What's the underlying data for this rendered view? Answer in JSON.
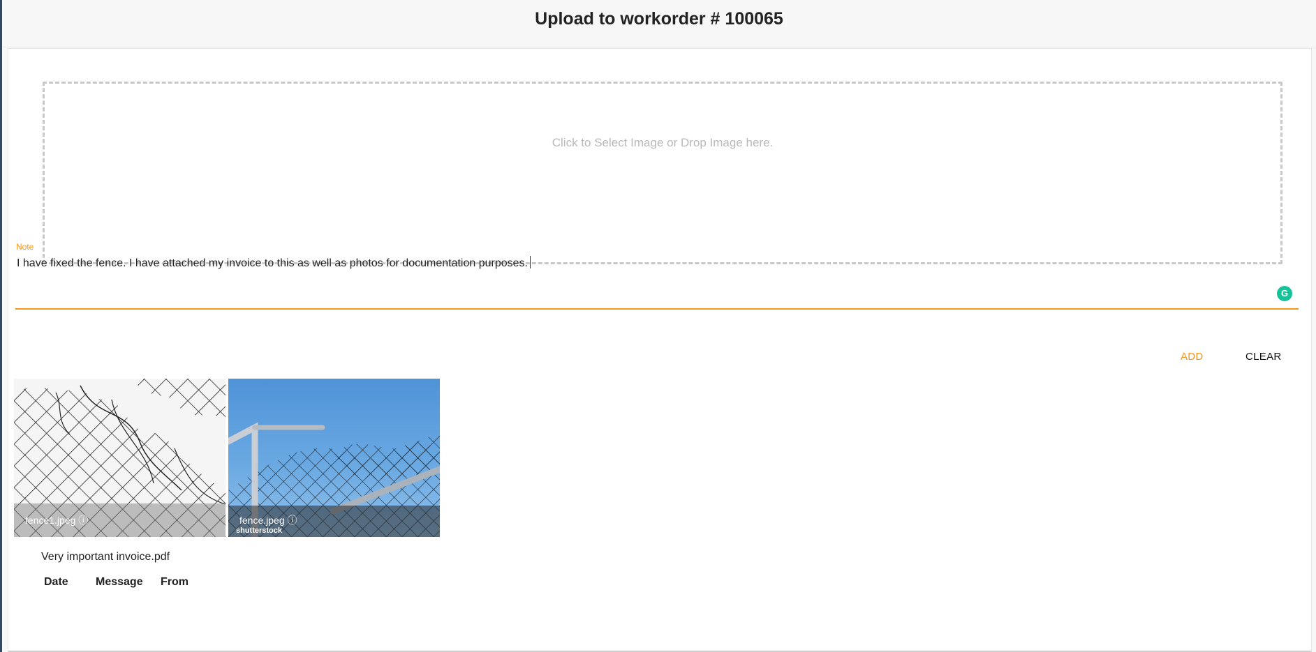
{
  "header": {
    "title": "Upload to workorder # 100065"
  },
  "dropzone": {
    "text": "Click to Select Image or Drop Image here."
  },
  "note": {
    "label": "Note",
    "value": "I have fixed the fence. I have attached my invoice to this as well as photos for documentation purposes.",
    "accent_color": "#f7941d",
    "grammarly_icon": "G"
  },
  "actions": {
    "add_label": "ADD",
    "clear_label": "CLEAR"
  },
  "attachments": [
    {
      "name": "fence1.jpeg ⓘ",
      "watermark": ""
    },
    {
      "name": "fence.jpeg ⓘ",
      "watermark": "shutterstock"
    }
  ],
  "files": [
    {
      "name": "Very important invoice.pdf"
    }
  ],
  "messages_table": {
    "columns": [
      "Date",
      "Message",
      "From"
    ]
  }
}
